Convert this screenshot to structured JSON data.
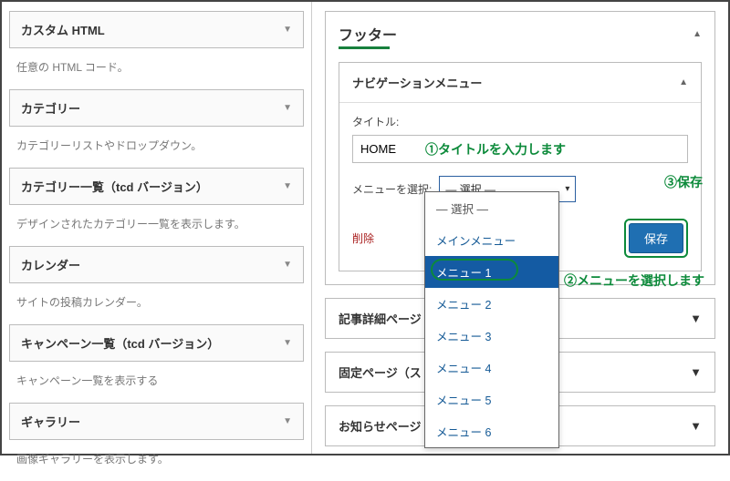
{
  "left": {
    "items": [
      {
        "title": "カスタム HTML",
        "desc": "任意の HTML コード。"
      },
      {
        "title": "カテゴリー",
        "desc": "カテゴリーリストやドロップダウン。"
      },
      {
        "title": "カテゴリー一覧（tcd バージョン）",
        "desc": "デザインされたカテゴリー一覧を表示します。"
      },
      {
        "title": "カレンダー",
        "desc": "サイトの投稿カレンダー。"
      },
      {
        "title": "キャンペーン一覧（tcd バージョン）",
        "desc": "キャンペーン一覧を表示する"
      },
      {
        "title": "ギャラリー",
        "desc": "画像ギャラリーを表示します。"
      }
    ]
  },
  "right": {
    "main_title": "フッター",
    "sub_title": "ナビゲーションメニュー",
    "field_title_label": "タイトル:",
    "field_title_value": "HOME",
    "select_label": "メニューを選択:",
    "select_current": "— 選択 —",
    "delete": "削除",
    "save": "保存",
    "collapsed": [
      "記事詳細ページ",
      "固定ページ（ス",
      "お知らせページ"
    ],
    "dropdown": [
      "— 選択 —",
      "メインメニュー",
      "メニュー 1",
      "メニュー 2",
      "メニュー 3",
      "メニュー 4",
      "メニュー 5",
      "メニュー 6"
    ]
  },
  "annotations": {
    "a1": "①タイトルを入力します",
    "a2": "②メニューを選択します",
    "a3": "③保存"
  }
}
